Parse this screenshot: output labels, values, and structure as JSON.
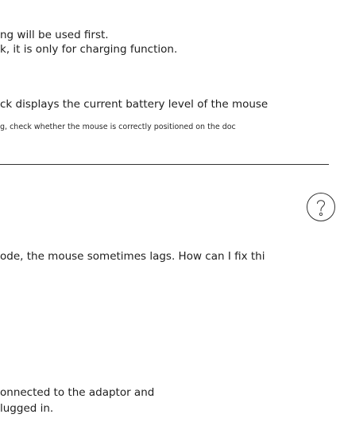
{
  "section_top": {
    "line1": "ng will be used first.",
    "line2": "k, it is only for charging function.",
    "line3": "ck displays the current battery level of the mouse",
    "note": "g, check whether the mouse is correctly positioned on the doc"
  },
  "faq": {
    "icon": "question-circle-icon",
    "question": "ode, the mouse sometimes lags. How can I fix thi",
    "answer_line1": "onnected to the adaptor and",
    "answer_line2": "lugged in."
  }
}
